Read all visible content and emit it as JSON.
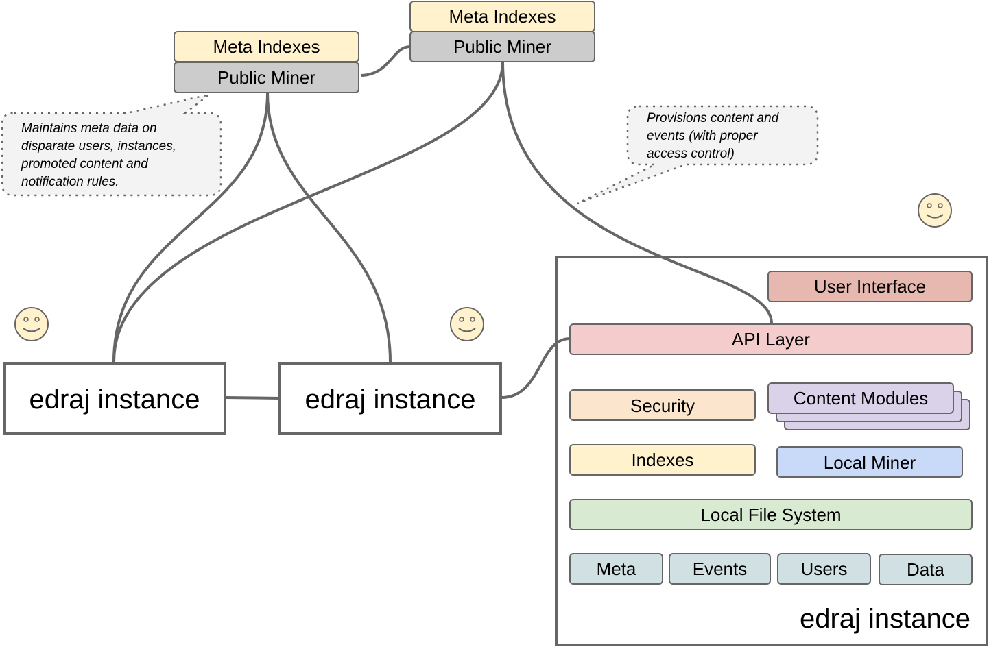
{
  "diagram": {
    "public_nodes": [
      {
        "id": "left",
        "top_label": "Meta Indexes",
        "bottom_label": "Public Miner"
      },
      {
        "id": "right",
        "top_label": "Meta Indexes",
        "bottom_label": "Public Miner"
      }
    ],
    "notes": [
      {
        "id": "miner-note",
        "lines": [
          "Maintains meta data on",
          "disparate users, instances,",
          "promoted content and",
          "notification rules."
        ]
      },
      {
        "id": "api-note",
        "lines": [
          "Provisions content and",
          "events  (with proper",
          "access control)"
        ]
      }
    ],
    "instances": [
      {
        "id": "instance-1",
        "label": "edraj instance"
      },
      {
        "id": "instance-2",
        "label": "edraj instance"
      }
    ],
    "detailed_instance": {
      "label": "edraj instance",
      "layers": {
        "user_interface": "User Interface",
        "api_layer": "API Layer",
        "security": "Security",
        "content_modules": "Content Modules",
        "indexes": "Indexes",
        "local_miner": "Local Miner",
        "local_file_system": "Local File System",
        "storage": [
          "Meta",
          "Events",
          "Users",
          "Data"
        ]
      }
    },
    "users": [
      {
        "icon": "smiley-face-icon"
      },
      {
        "icon": "smiley-face-icon"
      },
      {
        "icon": "smiley-face-icon"
      }
    ],
    "colors": {
      "meta_indexes": "#fff2cc",
      "public_miner": "#cccccc",
      "user_interface": "#e6b8af",
      "api_layer": "#f4cccc",
      "security": "#fce5cd",
      "content_modules": "#d9d2e9",
      "indexes": "#fff2cc",
      "local_miner": "#c9daf8",
      "local_file_system": "#d9ead3",
      "storage": "#d0e0e3",
      "note_fill": "#f3f3f3",
      "stroke": "#666666",
      "smiley": "#fff2cc"
    }
  }
}
